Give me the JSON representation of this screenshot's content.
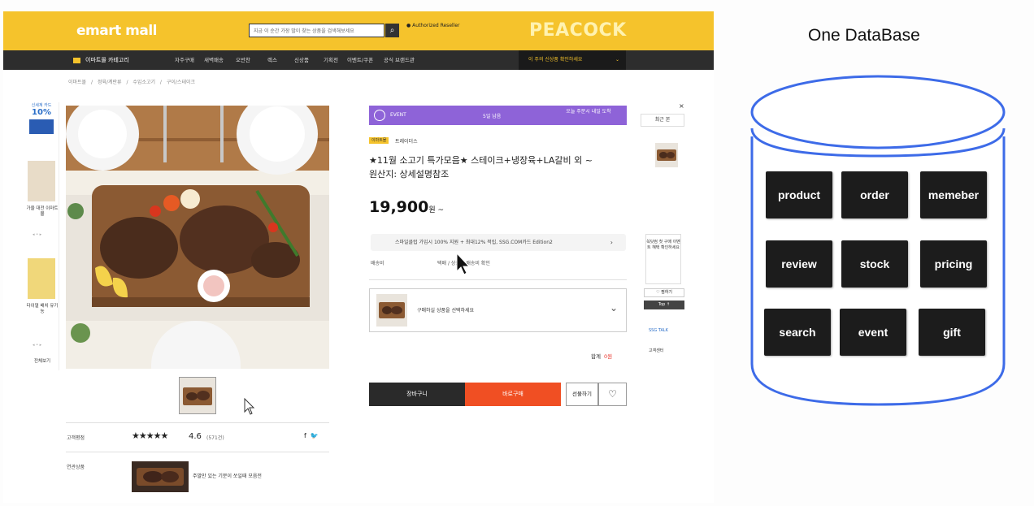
{
  "site": {
    "logo": "emart mall",
    "search_placeholder": "지금 이 순간 가장 많이 찾는 상품을 검색해보세요",
    "apple_badge": "Authorized Reseller",
    "peacock": "PEACOCK",
    "category_label": "이마트몰 카테고리",
    "nav": [
      "자주구매",
      "새벽배송",
      "오반찬",
      "렉스",
      "신상품",
      "기획전",
      "이벤트/쿠폰",
      "공식 브랜드관"
    ],
    "nav_promo": "이 주의 신상품 확인하세요",
    "breadcrumb": [
      "이마트몰",
      "정육/계란류",
      "수입소고기",
      "구이/스테이크"
    ]
  },
  "left_rail": {
    "ad_small": "신세계 카드",
    "ad_big": "10%",
    "ad_text_1": "가을 대전 이마트몰",
    "ad_text_2": "다이얼 배치 유기농",
    "footer": "전체보기"
  },
  "product": {
    "banner_left": "EVENT",
    "banner_mid": "5일 남음",
    "banner_right": "오늘 주문시 내일 도착",
    "tag": "이마트몰",
    "brand": "트레이더스",
    "title_line1": "★11월 소고기 특가모음★ 스테이크+냉장육+LA갈비 외 ~",
    "title_line2": "원산지: 상세설명참조",
    "price": "19,900",
    "price_unit": "원 ~",
    "promo": "스마일클럽 가입시 100% 지원 + 최대12% 적립, SSG.COM카드 Edition2",
    "ship_label": "배송비",
    "ship_value": "택배 / 상품별 배송비 확인",
    "option_text": "구매하실 상품을 선택하세요",
    "total_label": "합계",
    "total_value": "0원",
    "btn_cart": "장바구니",
    "btn_buy": "바로구매",
    "btn_gift": "선물하기",
    "review_label": "고객평점",
    "rating_stars": "★★★★★",
    "rating": "4.6",
    "rating_count": "(571건)",
    "cross_label": "연관상품",
    "cross_text": "주말만 있는 기분이 쏘일때 모음전"
  },
  "right_rail": {
    "head": "최근 본",
    "ad": "쓱닷컴 첫 구매 이벤트 혜택 확인하세요",
    "wish": "♡ 찜하기",
    "top": "Top ↑",
    "talk": "SSG TALK",
    "talk2": "고객센터"
  },
  "database": {
    "title": "One DataBase",
    "items": [
      "product",
      "order",
      "memeber",
      "review",
      "stock",
      "pricing",
      "search",
      "event",
      "gift"
    ]
  },
  "colors": {
    "yellow": "#f5c32c",
    "purple": "#8e63d8",
    "buy": "#f04f23",
    "db_outline": "#3d6be8"
  }
}
